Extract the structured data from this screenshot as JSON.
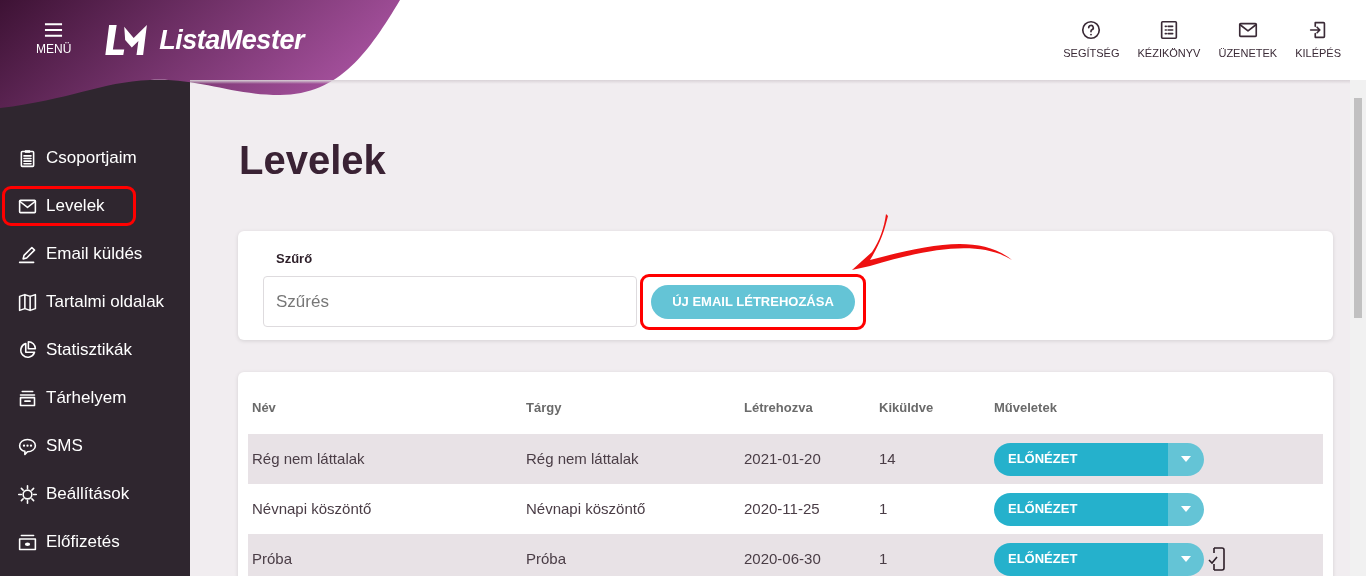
{
  "header": {
    "menu_label": "MENÜ",
    "logo_text": "ListaMester",
    "actions": [
      {
        "kind": "help",
        "label": "SEGÍTSÉG"
      },
      {
        "kind": "manual",
        "label": "KÉZIKÖNYV"
      },
      {
        "kind": "messages",
        "label": "ÜZENETEK"
      },
      {
        "kind": "logout",
        "label": "KILÉPÉS"
      }
    ]
  },
  "sidebar": {
    "items": [
      {
        "kind": "groups",
        "label": "Csoportjaim",
        "highlighted": false
      },
      {
        "kind": "letters",
        "label": "Levelek",
        "highlighted": true
      },
      {
        "kind": "send",
        "label": "Email küldés",
        "highlighted": false
      },
      {
        "kind": "pages",
        "label": "Tartalmi oldalak",
        "highlighted": false
      },
      {
        "kind": "stats",
        "label": "Statisztikák",
        "highlighted": false
      },
      {
        "kind": "storage",
        "label": "Tárhelyem",
        "highlighted": false
      },
      {
        "kind": "sms",
        "label": "SMS",
        "highlighted": false
      },
      {
        "kind": "settings",
        "label": "Beállítások",
        "highlighted": false
      },
      {
        "kind": "subscription",
        "label": "Előfizetés",
        "highlighted": false
      }
    ]
  },
  "page_title": "Levelek",
  "filter": {
    "label": "Szűrő",
    "placeholder": "Szűrés",
    "button": "ÚJ EMAIL LÉTREHOZÁSA",
    "button_highlighted": true
  },
  "table": {
    "columns": [
      "Név",
      "Tárgy",
      "Létrehozva",
      "Kiküldve",
      "Műveletek"
    ],
    "rows": [
      {
        "cells": [
          "Rég nem láttalak",
          "Rég nem láttalak",
          "2021-01-20",
          "14"
        ],
        "action": "ELŐNÉZET",
        "sms_check": false
      },
      {
        "cells": [
          "Névnapi köszöntő",
          "Névnapi köszöntő",
          "2020-11-25",
          "1"
        ],
        "action": "ELŐNÉZET",
        "sms_check": false
      },
      {
        "cells": [
          "Próba",
          "Próba",
          "2020-06-30",
          "1"
        ],
        "action": "ELŐNÉZET",
        "sms_check": true
      }
    ]
  }
}
